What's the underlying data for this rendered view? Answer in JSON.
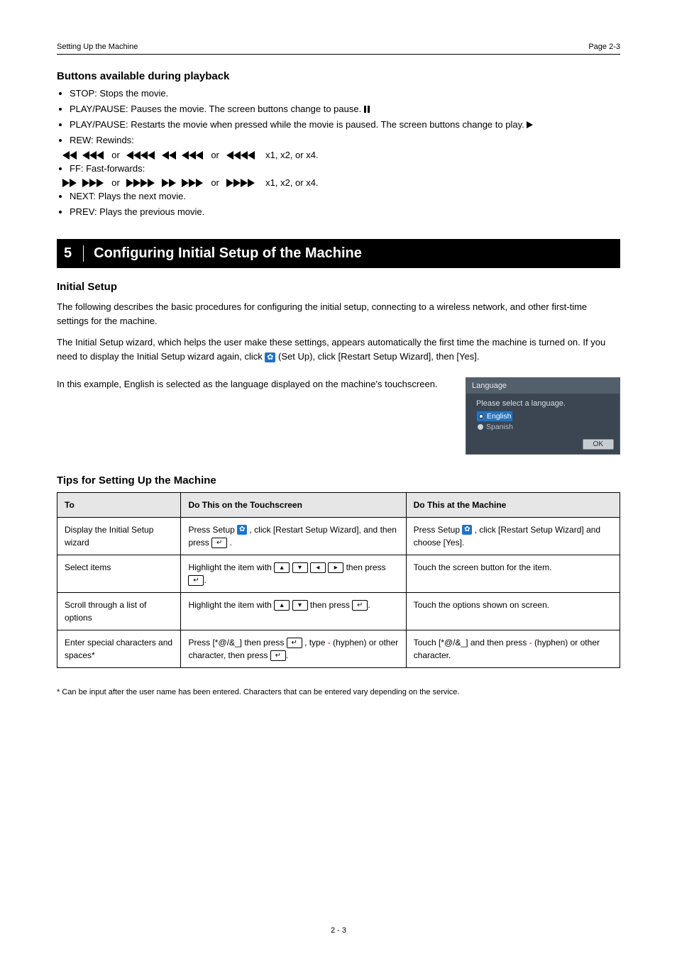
{
  "header": {
    "left": "Setting Up the Machine",
    "right_label": "Page",
    "page_num": "2-3"
  },
  "buttons_during": {
    "heading": "Buttons available during playback",
    "items": [
      "STOP: Stops the movie.",
      "PLAY/PAUSE: Pauses the movie. The screen buttons change to pause.",
      "PLAY/PAUSE: Restarts the movie when pressed while the movie is paused. The screen buttons change to play.",
      "REW: Rewinds:"
    ],
    "rew_speeds": "x1, x2, or x4.",
    "ff_label": "FF: Fast-forwards:",
    "ff_speeds": "x1, x2, or x4.",
    "next": "NEXT: Plays the next movie.",
    "prev": "PREV: Plays the previous movie."
  },
  "section5": {
    "num": "5",
    "title": "Configuring Initial Setup of the Machine"
  },
  "init": {
    "heading": "Initial Setup",
    "p1": "The following describes the basic procedures for configuring the initial setup, connecting to a wireless network, and other first-time settings for the machine.",
    "p2_pre": "The Initial Setup wizard, which helps the user make these settings, appears automatically the first time the machine is turned on. If you need to display the Initial Setup wizard again, click ",
    "p2_icon_label": "gear",
    "p2_post": " (Set Up), click [Restart Setup Wizard], then [Yes].",
    "p3": "In this example, English is selected as the language displayed on the machine's touchscreen.",
    "popup": {
      "title": "Language",
      "prompt": "Please select a language.",
      "opt_selected": "English",
      "opt_other": "Spanish",
      "ok": "OK"
    }
  },
  "tips": {
    "heading": "Tips for Setting Up the Machine",
    "col1": "To",
    "col2": "Do This on the Touchscreen",
    "col3": "Do This at the Machine",
    "rows": [
      {
        "to": "Display the Initial Setup wizard",
        "ts_pre": "Press Setup ",
        "ts_post1": ", click [Restart Setup Wizard], and then press ",
        "ts_post2": ".",
        "mc_pre": "Press Setup ",
        "mc_post": ", click [Restart Setup Wizard] and choose [Yes]."
      },
      {
        "to": "Select items",
        "ts_pre": "Highlight the item with ",
        "ts_post": " then press ",
        "mc": "Touch the screen button for the item."
      },
      {
        "to": "Scroll through a list of options",
        "ts_pre": "Highlight the item with ",
        "ts_post1": " then press ",
        "mc": "Touch the options shown on screen."
      },
      {
        "to": "Enter special characters and spaces*",
        "ts_pre": "Press [*@/&_] then press ",
        "ts_mid": ", type",
        "ts_post": " (hyphen) or other character, then press ",
        "mc_pre": "Touch [*@/&_] and then press",
        "mc_post": " (hyphen) or other character."
      }
    ]
  },
  "footnote": "* Can be input after the user name has been entered. Characters that can be entered vary depending on the service.",
  "footer": "2 - 3"
}
